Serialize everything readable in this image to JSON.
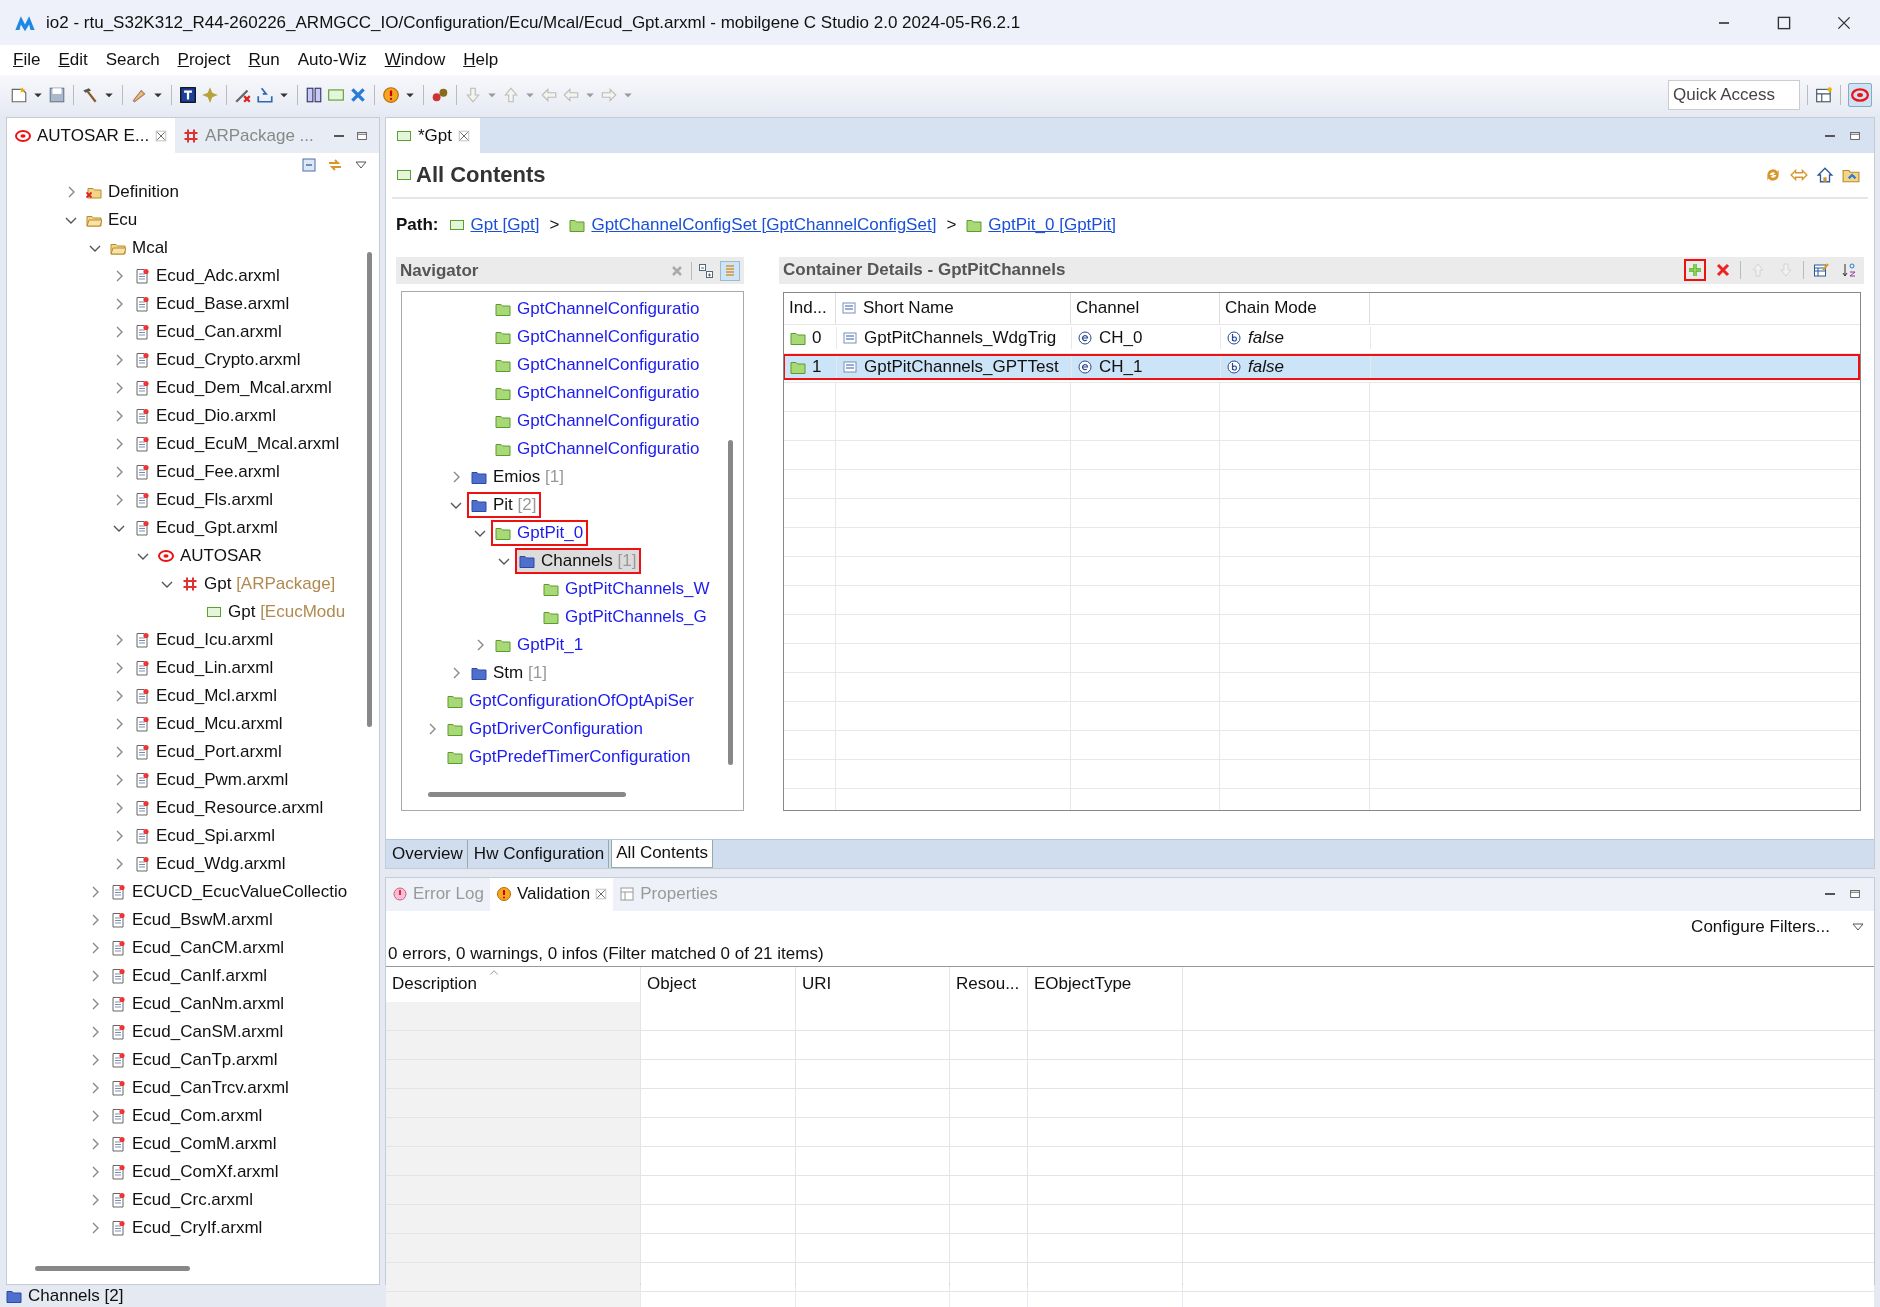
{
  "window": {
    "title": "io2 - rtu_S32K312_R44-260226_ARMGCC_IO/Configuration/Ecu/Mcal/Ecud_Gpt.arxml - mobilgene C Studio 2.0 2024-05-R6.2.1"
  },
  "menu": [
    {
      "label": "File",
      "mnemonic": true
    },
    {
      "label": "Edit",
      "mnemonic": true
    },
    {
      "label": "Search",
      "mnemonic": false
    },
    {
      "label": "Project",
      "mnemonic": true
    },
    {
      "label": "Run",
      "mnemonic": true
    },
    {
      "label": "Auto-Wiz",
      "mnemonic": false
    },
    {
      "label": "Window",
      "mnemonic": true
    },
    {
      "label": "Help",
      "mnemonic": true
    }
  ],
  "toolbar": {
    "quick_access": {
      "placeholder": "Quick Access"
    }
  },
  "explorer": {
    "tabs": [
      {
        "label": "AUTOSAR E...",
        "kind": "autosar",
        "selected": true,
        "closable": true
      },
      {
        "label": "ARPackage ...",
        "kind": "package",
        "selected": false,
        "closable": false
      }
    ],
    "tree": [
      {
        "label": "Definition",
        "kind": "definition",
        "expanded": false,
        "selected": false
      },
      {
        "label": "Ecu",
        "kind": "folder",
        "expanded": true,
        "selected": false,
        "children": [
          {
            "label": "Mcal",
            "kind": "folder",
            "expanded": true,
            "selected": false,
            "children": [
              {
                "label": "Ecud_Adc.arxml",
                "kind": "file",
                "expanded": false,
                "selected": false
              },
              {
                "label": "Ecud_Base.arxml",
                "kind": "file",
                "expanded": false,
                "selected": false
              },
              {
                "label": "Ecud_Can.arxml",
                "kind": "file",
                "expanded": false,
                "selected": false
              },
              {
                "label": "Ecud_Crypto.arxml",
                "kind": "file",
                "expanded": false,
                "selected": false
              },
              {
                "label": "Ecud_Dem_Mcal.arxml",
                "kind": "file",
                "expanded": false,
                "selected": false
              },
              {
                "label": "Ecud_Dio.arxml",
                "kind": "file",
                "expanded": false,
                "selected": false
              },
              {
                "label": "Ecud_EcuM_Mcal.arxml",
                "kind": "file",
                "expanded": false,
                "selected": false
              },
              {
                "label": "Ecud_Fee.arxml",
                "kind": "file",
                "expanded": false,
                "selected": false
              },
              {
                "label": "Ecud_Fls.arxml",
                "kind": "file",
                "expanded": false,
                "selected": false
              },
              {
                "label": "Ecud_Gpt.arxml",
                "kind": "file",
                "expanded": true,
                "selected": false,
                "children": [
                  {
                    "label": "AUTOSAR",
                    "kind": "autosar",
                    "expanded": true,
                    "selected": false,
                    "children": [
                      {
                        "label": "Gpt",
                        "suffix": "[ARPackage]",
                        "kind": "package",
                        "expanded": true,
                        "selected": false,
                        "children": [
                          {
                            "label": "Gpt",
                            "suffix": "[EcucModu",
                            "kind": "module",
                            "selected": false
                          }
                        ]
                      }
                    ]
                  }
                ]
              },
              {
                "label": "Ecud_Icu.arxml",
                "kind": "file",
                "expanded": false,
                "selected": false
              },
              {
                "label": "Ecud_Lin.arxml",
                "kind": "file",
                "expanded": false,
                "selected": false
              },
              {
                "label": "Ecud_Mcl.arxml",
                "kind": "file",
                "expanded": false,
                "selected": false
              },
              {
                "label": "Ecud_Mcu.arxml",
                "kind": "file",
                "expanded": false,
                "selected": false
              },
              {
                "label": "Ecud_Port.arxml",
                "kind": "file",
                "expanded": false,
                "selected": false
              },
              {
                "label": "Ecud_Pwm.arxml",
                "kind": "file",
                "expanded": false,
                "selected": false
              },
              {
                "label": "Ecud_Resource.arxml",
                "kind": "file",
                "expanded": false,
                "selected": false
              },
              {
                "label": "Ecud_Spi.arxml",
                "kind": "file",
                "expanded": false,
                "selected": false
              },
              {
                "label": "Ecud_Wdg.arxml",
                "kind": "file",
                "expanded": false,
                "selected": false
              }
            ]
          },
          {
            "label": "ECUCD_EcucValueCollectio",
            "kind": "file",
            "expanded": false,
            "selected": false
          },
          {
            "label": "Ecud_BswM.arxml",
            "kind": "file",
            "expanded": false,
            "selected": false
          },
          {
            "label": "Ecud_CanCM.arxml",
            "kind": "file",
            "expanded": false,
            "selected": false
          },
          {
            "label": "Ecud_CanIf.arxml",
            "kind": "file",
            "expanded": false,
            "selected": false
          },
          {
            "label": "Ecud_CanNm.arxml",
            "kind": "file",
            "expanded": false,
            "selected": false
          },
          {
            "label": "Ecud_CanSM.arxml",
            "kind": "file",
            "expanded": false,
            "selected": false
          },
          {
            "label": "Ecud_CanTp.arxml",
            "kind": "file",
            "expanded": false,
            "selected": false
          },
          {
            "label": "Ecud_CanTrcv.arxml",
            "kind": "file",
            "expanded": false,
            "selected": false
          },
          {
            "label": "Ecud_Com.arxml",
            "kind": "file",
            "expanded": false,
            "selected": false
          },
          {
            "label": "Ecud_ComM.arxml",
            "kind": "file",
            "expanded": false,
            "selected": false
          },
          {
            "label": "Ecud_ComXf.arxml",
            "kind": "file",
            "expanded": false,
            "selected": false
          },
          {
            "label": "Ecud_Crc.arxml",
            "kind": "file",
            "expanded": false,
            "selected": false
          },
          {
            "label": "Ecud_CryIf.arxml",
            "kind": "file",
            "expanded": false,
            "selected": false
          }
        ]
      }
    ]
  },
  "editor": {
    "tab": {
      "label": "*Gpt",
      "selected": true,
      "closable": true
    },
    "heading": "All Contents",
    "path": {
      "label": "Path:",
      "items": [
        {
          "text": "Gpt [Gpt]",
          "kind": "module"
        },
        {
          "text": ">",
          "kind": "separator"
        },
        {
          "text": "GptChannelConfigSet [GptChannelConfigSet]",
          "kind": "container"
        },
        {
          "text": ">",
          "kind": "separator"
        },
        {
          "text": "GptPit_0 [GptPit]",
          "kind": "container"
        }
      ]
    },
    "navigator": {
      "title": "Navigator",
      "tree": [
        {
          "children": [
            {
              "children": [
                {
                  "label": "GptChannelConfiguratio",
                  "kind": "container",
                  "selected": false
                },
                {
                  "label": "GptChannelConfiguratio",
                  "kind": "container",
                  "selected": false
                },
                {
                  "label": "GptChannelConfiguratio",
                  "kind": "container",
                  "selected": false
                },
                {
                  "label": "GptChannelConfiguratio",
                  "kind": "container",
                  "selected": false
                },
                {
                  "label": "GptChannelConfiguratio",
                  "kind": "container",
                  "selected": false
                },
                {
                  "label": "GptChannelConfiguratio",
                  "kind": "container",
                  "selected": false
                }
              ]
            },
            {
              "label": "Emios",
              "suffix": "[1]",
              "kind": "group",
              "expanded": false,
              "selected": false,
              "marked": false
            },
            {
              "label": "Pit",
              "suffix": "[2]",
              "kind": "group",
              "expanded": true,
              "selected": false,
              "marked": true,
              "children": [
                {
                  "label": "GptPit_0",
                  "kind": "container",
                  "expanded": true,
                  "selected": false,
                  "marked": true,
                  "children": [
                    {
                      "label": "Channels",
                      "suffix": "[1]",
                      "kind": "group",
                      "expanded": true,
                      "selected": true,
                      "marked": true,
                      "children": [
                        {
                          "label": "GptPitChannels_W",
                          "kind": "container",
                          "selected": false,
                          "marked": false
                        },
                        {
                          "label": "GptPitChannels_G",
                          "kind": "container",
                          "selected": false,
                          "marked": false
                        }
                      ]
                    }
                  ]
                },
                {
                  "label": "GptPit_1",
                  "kind": "container",
                  "expanded": false,
                  "selected": false,
                  "marked": false
                }
              ]
            },
            {
              "label": "Stm",
              "suffix": "[1]",
              "kind": "group",
              "expanded": false,
              "selected": false,
              "marked": false
            }
          ]
        },
        {
          "label": "GptConfigurationOfOptApiSer",
          "kind": "container",
          "selected": false,
          "marked": false
        },
        {
          "label": "GptDriverConfiguration",
          "kind": "container",
          "expanded": false,
          "selected": false,
          "marked": false
        },
        {
          "label": "GptPredefTimerConfiguration",
          "kind": "container",
          "selected": false,
          "marked": false
        }
      ]
    },
    "details": {
      "title": "Container Details - GptPitChannels",
      "actions": [
        {
          "kind": "add",
          "disabled": false,
          "marked": true
        },
        {
          "kind": "delete",
          "disabled": false,
          "marked": false
        },
        {
          "kind": "up",
          "disabled": true,
          "marked": false
        },
        {
          "kind": "down",
          "disabled": true,
          "marked": false
        },
        {
          "kind": "edit",
          "disabled": false,
          "marked": false
        },
        {
          "kind": "sort",
          "disabled": false,
          "marked": false
        }
      ],
      "columns": [
        "Ind...",
        "Short Name",
        "Channel",
        "Chain Mode"
      ],
      "rows": [
        {
          "index": "0",
          "short_name": "GptPitChannels_WdgTrig",
          "channel": "CH_0",
          "chain_mode": "false",
          "selected": false,
          "marked": false
        },
        {
          "index": "1",
          "short_name": "GptPitChannels_GPTTest",
          "channel": "CH_1",
          "chain_mode": "false",
          "selected": true,
          "marked": true
        }
      ]
    },
    "page_tabs": [
      {
        "label": "Overview",
        "selected": false
      },
      {
        "label": "Hw Configuration",
        "selected": false
      },
      {
        "label": "All Contents",
        "selected": true
      }
    ]
  },
  "problems": {
    "tabs": [
      {
        "label": "Error Log",
        "kind": "log",
        "selected": false,
        "closable": false
      },
      {
        "label": "Validation",
        "kind": "validation",
        "selected": true,
        "closable": true
      },
      {
        "label": "Properties",
        "kind": "properties",
        "selected": false,
        "closable": false
      }
    ],
    "filters": "Configure Filters...",
    "summary": "0 errors, 0 warnings, 0 infos (Filter matched 0 of 21 items)",
    "columns": [
      "Description",
      "Object",
      "URI",
      "Resou...",
      "EObjectType"
    ]
  },
  "status_bar": {
    "text": "Channels [2]"
  }
}
